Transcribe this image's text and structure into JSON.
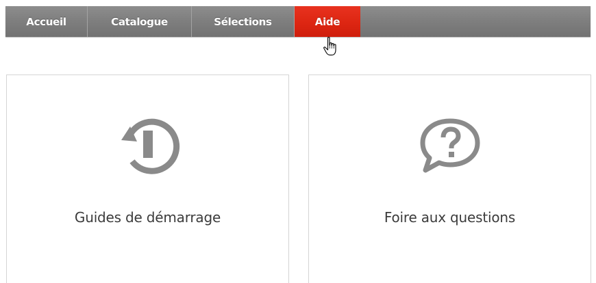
{
  "navbar": {
    "items": [
      {
        "label": "Accueil",
        "active": false
      },
      {
        "label": "Catalogue",
        "active": false
      },
      {
        "label": "Sélections",
        "active": false
      },
      {
        "label": "Aide",
        "active": true
      }
    ]
  },
  "cards": [
    {
      "label": "Guides de démarrage",
      "icon": "restart-power-icon"
    },
    {
      "label": "Foire aux questions",
      "icon": "question-bubble-icon"
    }
  ],
  "colors": {
    "nav_background": "#7e7e7e",
    "nav_active": "#dd2612",
    "icon_gray": "#8a8a8a",
    "card_border": "#d4d4d4",
    "label_text": "#3b3b3b"
  },
  "cursor": {
    "icon": "hand-pointer-icon"
  }
}
